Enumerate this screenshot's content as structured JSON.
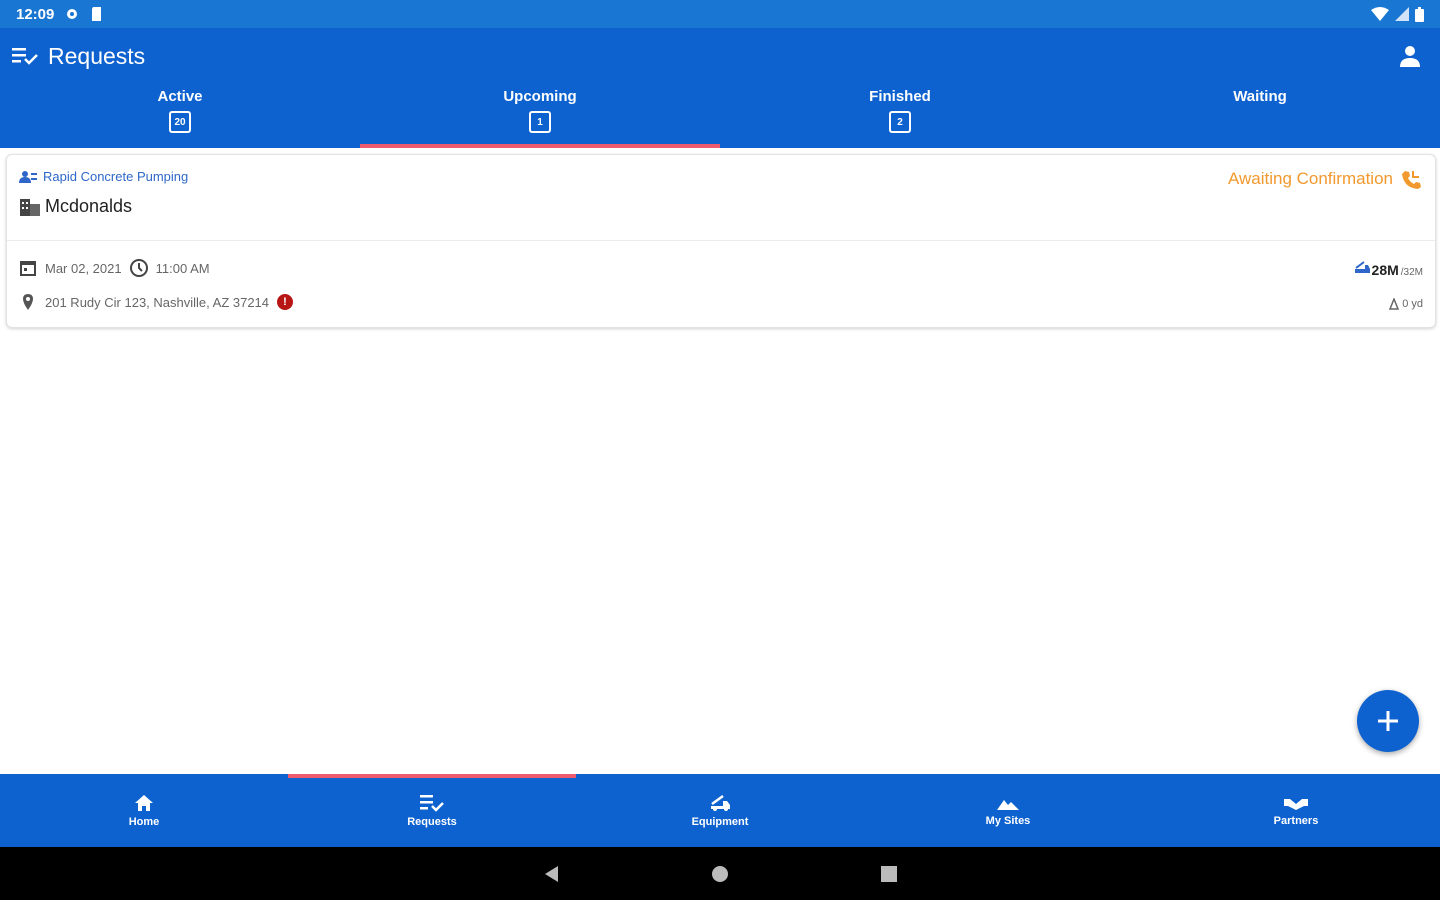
{
  "status_bar": {
    "time": "12:09"
  },
  "app_bar": {
    "title": "Requests"
  },
  "tabs": [
    {
      "label": "Active",
      "count": "20",
      "active": false
    },
    {
      "label": "Upcoming",
      "count": "1",
      "active": true
    },
    {
      "label": "Finished",
      "count": "2",
      "active": false
    },
    {
      "label": "Waiting",
      "count": "",
      "active": false
    }
  ],
  "request_card": {
    "company": "Rapid Concrete Pumping",
    "site": "Mcdonalds",
    "status": "Awaiting Confirmation",
    "date": "Mar 02, 2021",
    "time": "11:00 AM",
    "address": "201 Rudy Cir 123, Nashville, AZ 37214",
    "error_mark": "!",
    "equipment_size": "28M",
    "equipment_capacity": "/32M",
    "volume": "0 yd"
  },
  "bottom_nav": [
    {
      "label": "Home",
      "icon": "home-icon",
      "active": false
    },
    {
      "label": "Requests",
      "icon": "requests-icon",
      "active": true
    },
    {
      "label": "Equipment",
      "icon": "equipment-icon",
      "active": false
    },
    {
      "label": "My Sites",
      "icon": "sites-icon",
      "active": false
    },
    {
      "label": "Partners",
      "icon": "partners-icon",
      "active": false
    }
  ],
  "colors": {
    "primary": "#0d62cf",
    "status_bar": "#1976d2",
    "indicator": "#ef5b6e",
    "status_text": "#f2992e",
    "company_text": "#2e67c9"
  }
}
